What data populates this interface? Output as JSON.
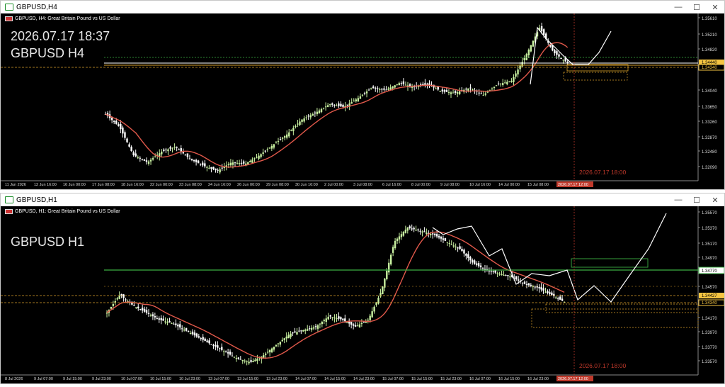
{
  "top": {
    "window_title": "GBPUSD,H4",
    "header": "GBPUSD, H4:  Great Britain Pound vs US Dollar",
    "datetime_overlay": "2026.07.17 18:37",
    "symbol_overlay": "GBPUSD H4",
    "price_labels": [
      "1.35610",
      "1.35210",
      "1.34820",
      "1.34440",
      "1.34340",
      "1.34040",
      "1.33650",
      "1.33260",
      "1.32870",
      "1.32480",
      "1.32090",
      "1.31700"
    ],
    "highlight_labels": [
      "1.34440",
      "1.34340"
    ],
    "time_labels": [
      "11 Jun 2026",
      "12 Jun 16:00",
      "16 Jun 00:00",
      "17 Jun 08:00",
      "18 Jun 16:00",
      "22 Jun 00:00",
      "23 Jun 08:00",
      "24 Jun 16:00",
      "26 Jun 00:00",
      "29 Jun 08:00",
      "30 Jun 16:00",
      "2 Jul 00:00",
      "3 Jul 08:00",
      "6 Jul 16:00",
      "8 Jul 00:00",
      "9 Jul 08:00",
      "10 Jul 16:00",
      "14 Jul 00:00",
      "15 Jul 08:00"
    ],
    "cursor_time": "2026.07.17 12:00",
    "vline_label": "2026.07.17 18:00"
  },
  "bottom": {
    "window_title": "GBPUSD,H1",
    "header": "GBPUSD, H1:  Great Britain Pound vs US Dollar",
    "symbol_overlay": "GBPUSD H1",
    "price_labels": [
      "1.35570",
      "1.35370",
      "1.35170",
      "1.34970",
      "1.34770",
      "1.34570",
      "1.34370",
      "1.34170",
      "1.33970",
      "1.33770",
      "1.33570"
    ],
    "hline_label": "1.34770",
    "highlight_labels": [
      "1.34427",
      "1.34340"
    ],
    "time_labels": [
      "8 Jul 2026",
      "9 Jul 07:00",
      "9 Jul 15:00",
      "9 Jul 23:00",
      "10 Jul 07:00",
      "10 Jul 15:00",
      "10 Jul 23:00",
      "13 Jul 07:00",
      "13 Jul 15:00",
      "13 Jul 23:00",
      "14 Jul 07:00",
      "14 Jul 15:00",
      "14 Jul 23:00",
      "15 Jul 07:00",
      "15 Jul 15:00",
      "15 Jul 23:00",
      "16 Jul 07:00",
      "16 Jul 15:00",
      "16 Jul 23:00"
    ],
    "cursor_time": "2026.07.17 12:00",
    "vline_label": "2026.07.17 18:00"
  },
  "colors": {
    "bull": "#c8f0a0",
    "bear": "#ffffff",
    "ma": "#e0584a",
    "green_line": "#3cb043",
    "dash_orange": "#d9a02a",
    "vline": "#c0392b",
    "label_bg": "#f5c542"
  }
}
